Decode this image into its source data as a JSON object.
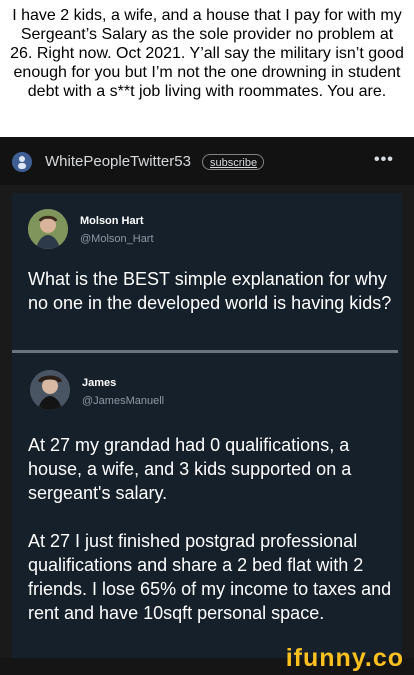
{
  "caption": "I have 2 kids, a wife, and a house that I pay for with my Sergeant’s Salary as the sole provider no problem at 26. Right now. Oct 2021. Y’all say the military isn’t good enough for you but I’m not the one drowning in student debt with a s**t job living with roommates. You are.",
  "subreddit": {
    "name": "WhitePeopleTwitter53",
    "subscribe_label": "subscribe",
    "more_label": "•••"
  },
  "tweet1": {
    "name": "Molson Hart",
    "handle": "@Molson_Hart",
    "text": "What is the BEST simple explanation for why no one in the developed world is having kids?"
  },
  "tweet2": {
    "name": "James",
    "handle": "@JamesManuell",
    "text_p1": "At 27 my grandad had 0 qualifications, a house, a wife, and 3 kids supported on a sergeant's salary.",
    "text_p2": "At 27 I just finished postgrad professional qualifications and share a 2 bed flat with 2 friends. I lose 65% of my income to taxes and rent and have 10sqft personal space."
  },
  "watermark": "ifunny.co",
  "colors": {
    "brand": "#fcc11f",
    "tweet_bg": "#15202b",
    "handle": "#8b98a5"
  }
}
